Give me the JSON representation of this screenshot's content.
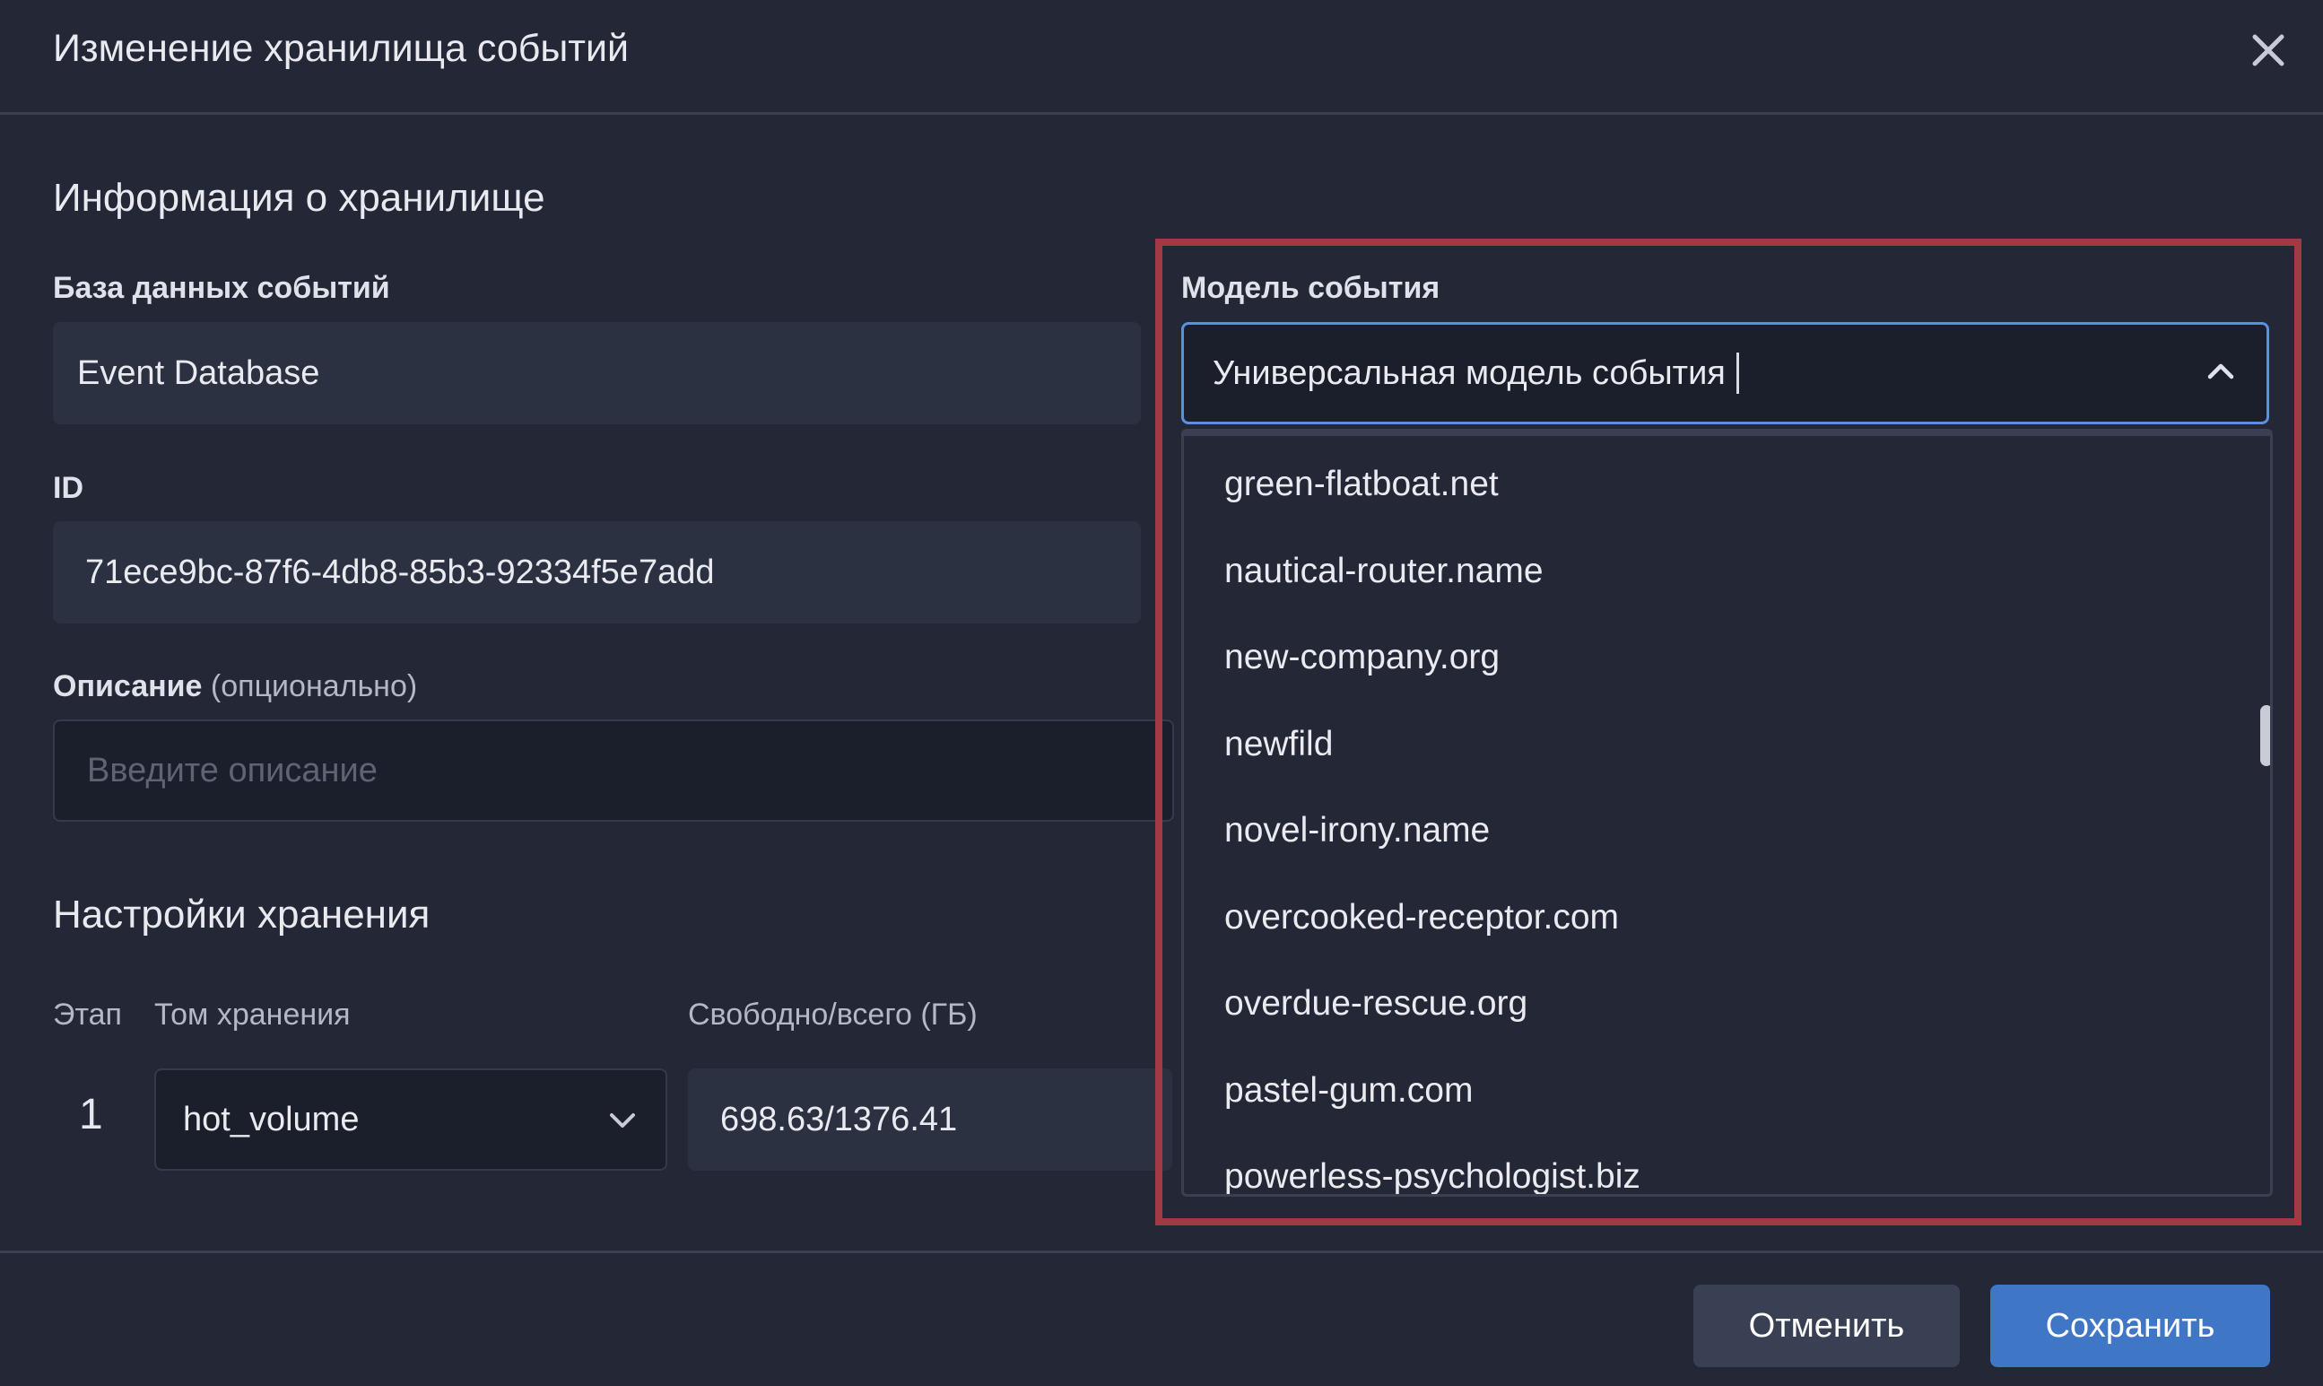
{
  "dialog": {
    "title": "Изменение хранилища событий",
    "close_icon": "close-icon"
  },
  "info_section": {
    "title": "Информация о хранилище",
    "database_label": "База данных событий",
    "database_value": "Event Database",
    "id_label": "ID",
    "id_value": "71ece9bc-87f6-4db8-85b3-92334f5e7add",
    "description_label": "Описание",
    "description_optional": "(опционально)",
    "description_placeholder": "Введите описание"
  },
  "event_model": {
    "label": "Модель события",
    "value": "Универсальная модель события",
    "toggle_icon": "chevron-up-icon",
    "options": [
      "green-flatboat.net",
      "nautical-router.name",
      "new-company.org",
      "newfild",
      "novel-irony.name",
      "overcooked-receptor.com",
      "overdue-rescue.org",
      "pastel-gum.com",
      "powerless-psychologist.biz"
    ]
  },
  "storage_section": {
    "title": "Настройки хранения",
    "col_stage": "Этап",
    "col_volume": "Том хранения",
    "col_free": "Свободно/всего (ГБ)",
    "row": {
      "stage": "1",
      "volume": "hot_volume",
      "volume_icon": "chevron-down-icon",
      "free_total": "698.63/1376.41"
    }
  },
  "footer": {
    "cancel_label": "Отменить",
    "save_label": "Сохранить"
  },
  "colors": {
    "background": "#232736",
    "accent": "#3f76c6",
    "focus_border": "#5b8fe0",
    "highlight": "#a13a45"
  }
}
